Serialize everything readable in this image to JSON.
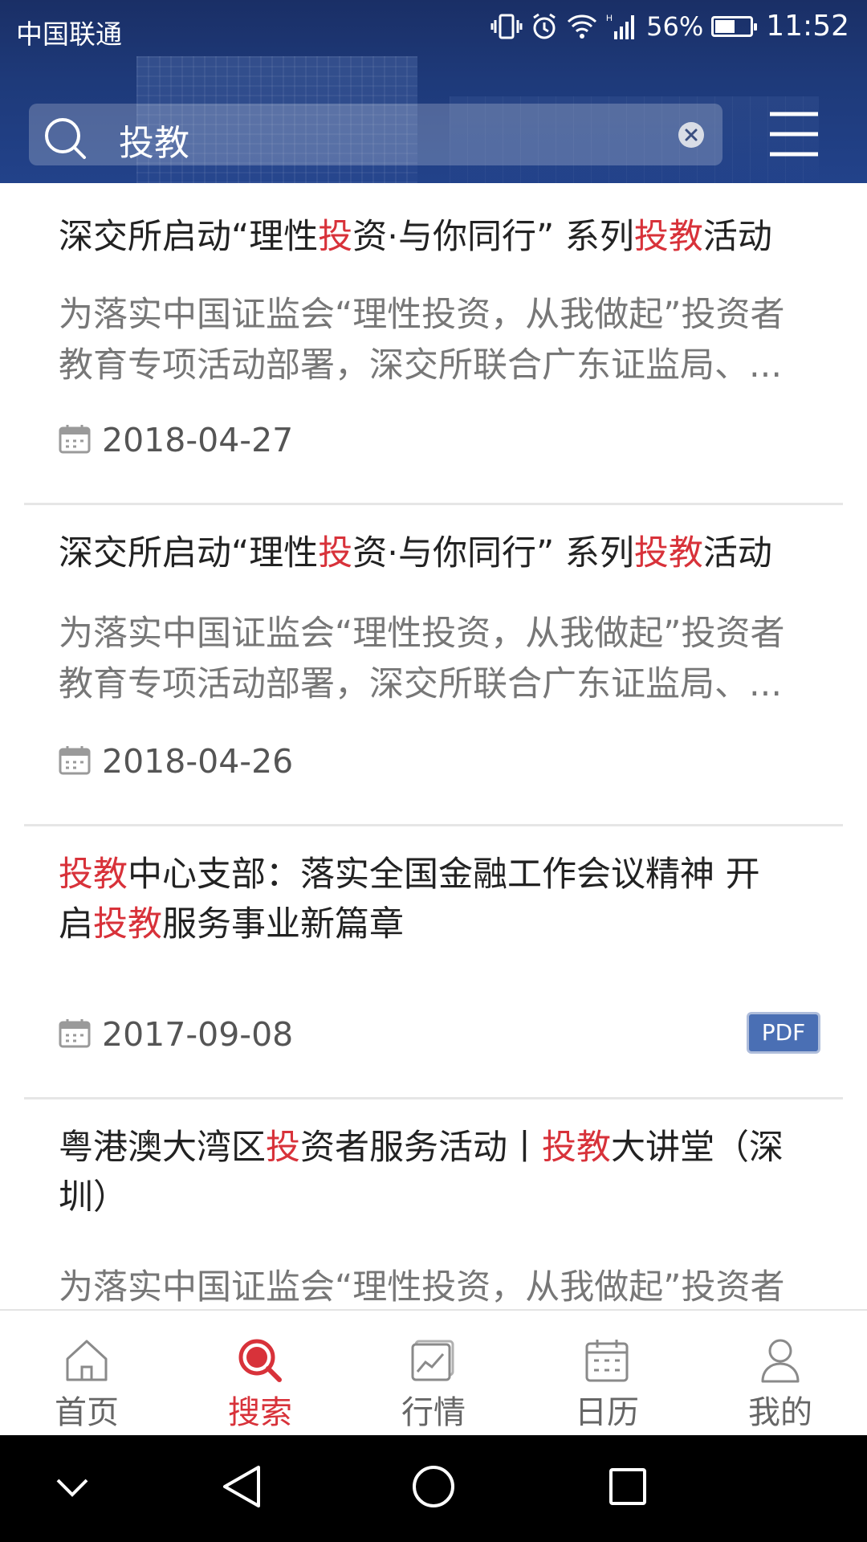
{
  "status_bar": {
    "carrier": "中国联通",
    "battery_percent": "56%",
    "battery_level": 0.56,
    "time": "11:52",
    "icons": [
      "vibrate-icon",
      "alarm-icon",
      "wifi-icon",
      "signal-icon",
      "battery-icon"
    ]
  },
  "search": {
    "value": "投教"
  },
  "results": [
    {
      "title_parts": [
        {
          "text": "深交所启动“理性",
          "hl": false
        },
        {
          "text": "投",
          "hl": true
        },
        {
          "text": "资·与你同行” 系列",
          "hl": false
        },
        {
          "text": "投教",
          "hl": true
        },
        {
          "text": "活动",
          "hl": false
        }
      ],
      "summary_line1": "为落实中国证监会“理性投资，从我做起”投资者",
      "summary_line2": "教育专项活动部署，深交所联合广东证监局、...",
      "date": "2018-04-27"
    },
    {
      "title_parts": [
        {
          "text": "深交所启动“理性",
          "hl": false
        },
        {
          "text": "投",
          "hl": true
        },
        {
          "text": "资·与你同行” 系列",
          "hl": false
        },
        {
          "text": "投教",
          "hl": true
        },
        {
          "text": "活动",
          "hl": false
        }
      ],
      "summary_line1": "为落实中国证监会“理性投资，从我做起”投资者",
      "summary_line2": "教育专项活动部署，深交所联合广东证监局、...",
      "date": "2018-04-26"
    },
    {
      "title_line1_parts": [
        {
          "text": "投教",
          "hl": true
        },
        {
          "text": "中心支部：落实全国金融工作会议精神 开",
          "hl": false
        }
      ],
      "title_line2_parts": [
        {
          "text": "启",
          "hl": false
        },
        {
          "text": "投教",
          "hl": true
        },
        {
          "text": "服务事业新篇章",
          "hl": false
        }
      ],
      "date": "2017-09-08",
      "badge": "PDF"
    },
    {
      "title_line1_parts": [
        {
          "text": "粤港澳大湾区",
          "hl": false
        },
        {
          "text": "投",
          "hl": true
        },
        {
          "text": "资者服务活动丨",
          "hl": false
        },
        {
          "text": "投教",
          "hl": true
        },
        {
          "text": "大讲堂（深",
          "hl": false
        }
      ],
      "title_line2": "圳）",
      "summary_line1": "为落实中国证监会“理性投资，从我做起”投资者"
    }
  ],
  "bottom_nav": [
    {
      "label": "首页",
      "icon": "home-icon",
      "active": false
    },
    {
      "label": "搜索",
      "icon": "search-icon",
      "active": true
    },
    {
      "label": "行情",
      "icon": "chart-icon",
      "active": false
    },
    {
      "label": "日历",
      "icon": "calendar-icon",
      "active": false
    },
    {
      "label": "我的",
      "icon": "user-icon",
      "active": false
    }
  ],
  "colors": {
    "header_bg": "#1e3a7a",
    "highlight": "#d8323a",
    "pdf_badge": "#4a6fb4",
    "text_primary": "#222222",
    "text_secondary": "#777777"
  }
}
